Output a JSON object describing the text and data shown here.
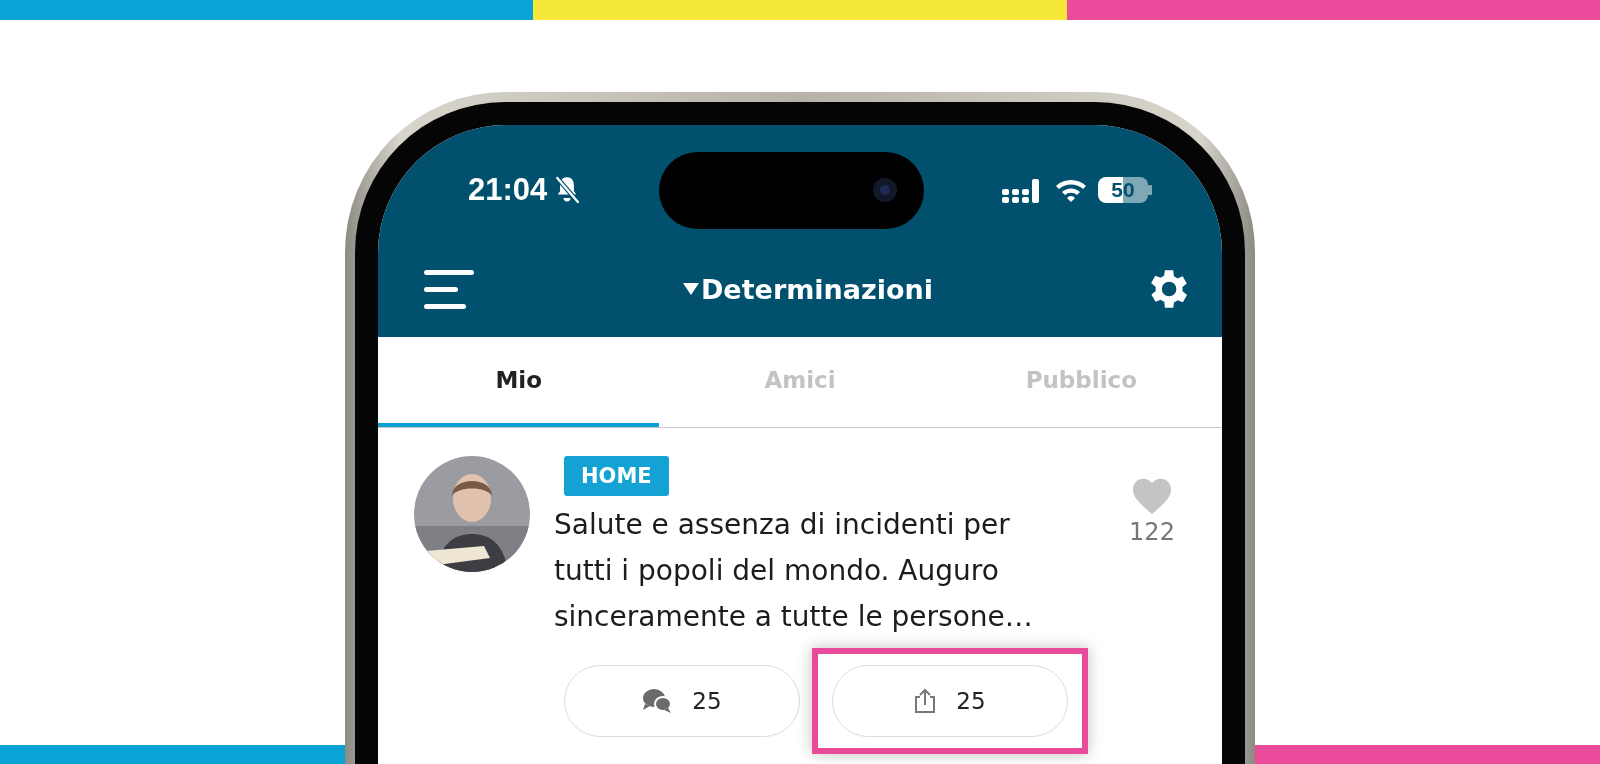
{
  "status_bar": {
    "time": "21:04",
    "silent": true,
    "battery": "50"
  },
  "header": {
    "title": "Determinazioni"
  },
  "tabs": [
    {
      "label": "Mio",
      "selected": true
    },
    {
      "label": "Amici",
      "selected": false
    },
    {
      "label": "Pubblico",
      "selected": false
    }
  ],
  "post": {
    "tag": "HOME",
    "text": "Salute e assenza di incidenti per tutti i popoli del mondo. Auguro sinceramente a tutte le persone…",
    "liked": false,
    "likes": "122",
    "comments": "25",
    "shares": "25",
    "share_highlighted": true
  }
}
